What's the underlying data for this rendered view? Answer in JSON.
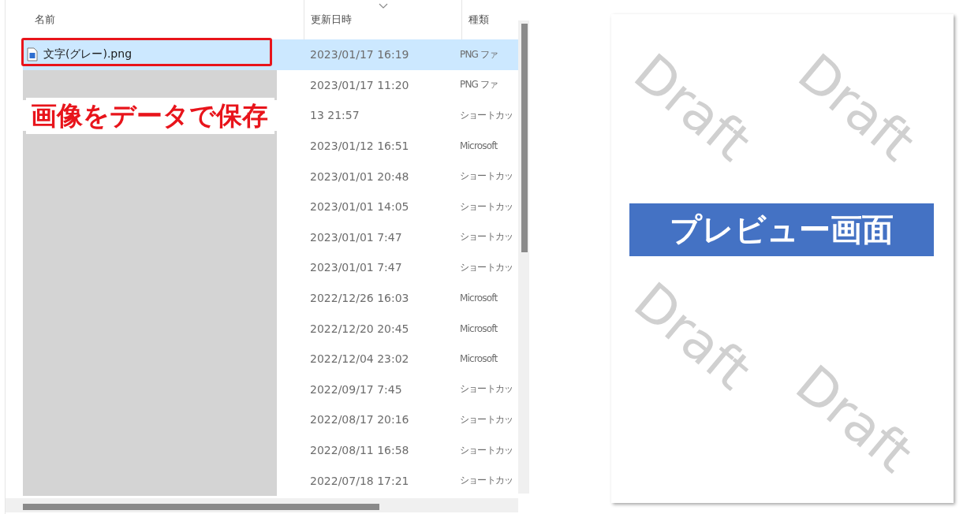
{
  "file_list": {
    "columns": [
      {
        "label": "名前"
      },
      {
        "label": "更新日時"
      },
      {
        "label": "種類"
      }
    ],
    "rows": [
      {
        "name": "文字(グレー).png",
        "modified": "2023/01/17 16:19",
        "type": "PNG ファ",
        "selected": true,
        "redacted": false
      },
      {
        "modified": "2023/01/17 11:20",
        "type": "PNG ファ",
        "selected": false,
        "redacted": true
      },
      {
        "modified": "13 21:57",
        "type": "ショートカッ",
        "selected": false,
        "redacted": false
      },
      {
        "modified": "2023/01/12 16:51",
        "type": "Microsoft",
        "selected": false,
        "redacted": true
      },
      {
        "modified": "2023/01/01 20:48",
        "type": "ショートカッ",
        "selected": false,
        "redacted": true
      },
      {
        "modified": "2023/01/01 14:05",
        "type": "ショートカッ",
        "selected": false,
        "redacted": true
      },
      {
        "modified": "2023/01/01 7:47",
        "type": "ショートカッ",
        "selected": false,
        "redacted": true
      },
      {
        "modified": "2023/01/01 7:47",
        "type": "ショートカッ",
        "selected": false,
        "redacted": true
      },
      {
        "modified": "2022/12/26 16:03",
        "type": "Microsoft",
        "selected": false,
        "redacted": true
      },
      {
        "modified": "2022/12/20 20:45",
        "type": "Microsoft",
        "selected": false,
        "redacted": true
      },
      {
        "modified": "2022/12/04 23:02",
        "type": "Microsoft",
        "selected": false,
        "redacted": true
      },
      {
        "modified": "2022/09/17 7:45",
        "type": "ショートカッ",
        "selected": false,
        "redacted": true
      },
      {
        "modified": "2022/08/17 20:16",
        "type": "ショートカッ",
        "selected": false,
        "redacted": true
      },
      {
        "modified": "2022/08/11 16:58",
        "type": "ショートカッ",
        "selected": false,
        "redacted": true
      },
      {
        "modified": "2022/07/18 17:21",
        "type": "ショートカッ",
        "selected": false,
        "redacted": true
      }
    ]
  },
  "annotation": {
    "text": "画像をデータで保存"
  },
  "preview": {
    "banner": "プレビュー画面",
    "watermarks": [
      "Draft",
      "Draft",
      "Draft",
      "Draft"
    ]
  }
}
